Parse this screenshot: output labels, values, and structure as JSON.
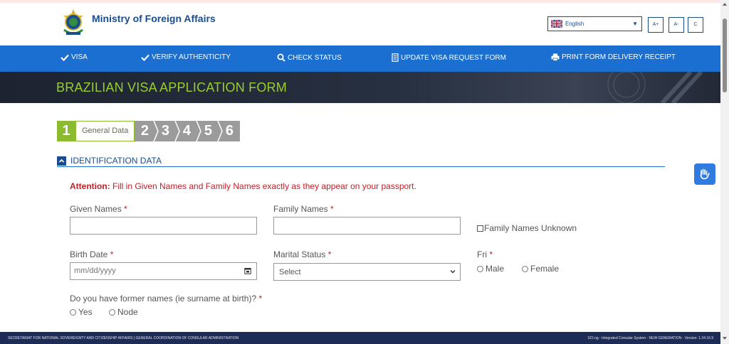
{
  "header": {
    "ministry": "Ministry of Foreign Affairs",
    "language": {
      "selected": "English",
      "flag_icon": "uk-flag-icon"
    },
    "font_controls": [
      "A+",
      "A-",
      "C"
    ]
  },
  "nav": {
    "items": [
      {
        "label": "VISA",
        "icon": "check-icon"
      },
      {
        "label": "VERIFY AUTHENTICITY",
        "icon": "check-icon"
      },
      {
        "label": "CHECK STATUS",
        "icon": "search-icon"
      },
      {
        "label": "UPDATE VISA REQUEST FORM",
        "icon": "document-icon"
      },
      {
        "label": "PRINT FORM DELIVERY RECEIPT",
        "icon": "print-icon"
      }
    ]
  },
  "banner": {
    "title": "BRAZILIAN VISA APPLICATION FORM"
  },
  "stepper": {
    "current": "1",
    "current_label": "General Data",
    "steps": [
      "2",
      "3",
      "4",
      "5",
      "6"
    ]
  },
  "section": {
    "title": "IDENTIFICATION DATA",
    "attention_prefix": "Attention:",
    "attention_text": " Fill in Given Names and Family Names exactly as they appear on your passport."
  },
  "form": {
    "given_names": {
      "label": "Given Names ",
      "required": "*",
      "value": ""
    },
    "family_names": {
      "label": "Family Names ",
      "required": "*",
      "value": ""
    },
    "family_unknown": {
      "label": "Family Names Unknown",
      "checked": false
    },
    "birth_date": {
      "label": "Birth Date ",
      "required": "*",
      "placeholder": "mm/dd/yyyy"
    },
    "marital_status": {
      "label": "Marital Status ",
      "required": "*",
      "placeholder": "Select"
    },
    "gender": {
      "label": "Fri ",
      "required": "*",
      "options": [
        "Male",
        "Female"
      ]
    },
    "former_names": {
      "label": "Do you have former names (ie surname at birth)? ",
      "required": "*",
      "options": [
        "Yes",
        "Node"
      ]
    }
  },
  "footer": {
    "left": "SECRETARIAT FOR NATIONAL SOVEREIGNTY AND CITIZENSHIP AFFAIRS | GENERAL COORDINATION OF CONSULAR ADMINISTRATION",
    "right": "SCI.ng - Integrated Consular System - NEW GENERATION - Version: 1.24.16.9"
  },
  "colors": {
    "nav_blue": "#1b6fd1",
    "title_blue": "#1a4c8e",
    "step_green": "#8dbb2f",
    "step_gray": "#9b9b9b",
    "banner_text": "#9acd32",
    "required_red": "#c0202a",
    "footer_navy": "#1d2b57"
  }
}
